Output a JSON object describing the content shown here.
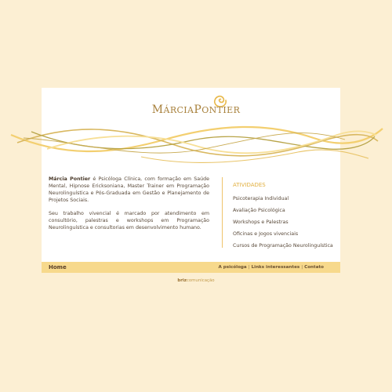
{
  "logo": {
    "marcia_initial": "M",
    "marcia_rest": "ÁRCIA",
    "pontier_initial": "P",
    "pontier_rest": "ONTIER",
    "alt": "Márcia Pontier"
  },
  "intro": {
    "name": "Márcia Pontier",
    "paragraph1_rest": " é Psicóloga Clínica, com formação em Saúde Mental, Hipnose Ericksoniana, Master Trainer em Programação Neurolinguística e Pós-Graduada em Gestão e Planejamento de Projetos Sociais.",
    "paragraph2": "Seu trabalho vivencial é marcado por atendimento em consultório, palestras e workshops em Programação Neurolinguística e consultorias em desenvolvimento humano."
  },
  "activities": {
    "title": "ATIVIDADES",
    "items": [
      "Psicoterapia Individual",
      "Avaliação Psicológica",
      "Workshops e Palestras",
      "Oficinas e Jogos vivenciais",
      "Cursos de Programação Neurolinguística"
    ]
  },
  "footer": {
    "home": "Home",
    "links": [
      "A psicóloga",
      "Links interessantes",
      "Contato"
    ],
    "separator": "|"
  },
  "credit": {
    "brand": "briz",
    "rest": "comunicação"
  },
  "colors": {
    "page_background": "#fcefd3",
    "card_background": "#ffffff",
    "footer_bar": "#f7d98c",
    "accent_gold": "#e2b040",
    "logo_text": "#a8813c"
  }
}
